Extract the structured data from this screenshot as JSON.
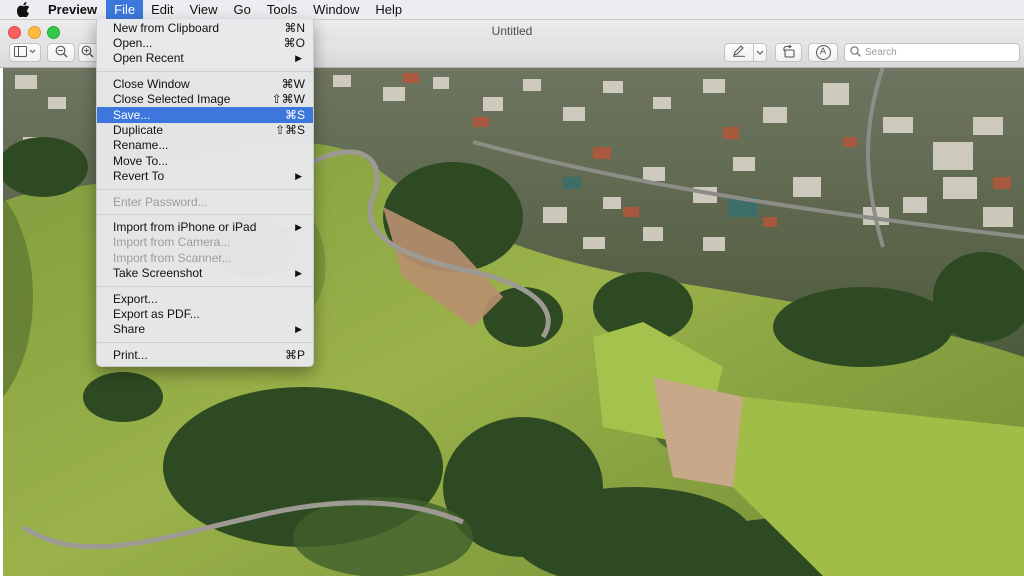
{
  "menubar": {
    "app_name": "Preview",
    "menus": [
      "File",
      "Edit",
      "View",
      "Go",
      "Tools",
      "Window",
      "Help"
    ],
    "active_menu": "File"
  },
  "window": {
    "title": "Untitled"
  },
  "toolbar": {
    "search_placeholder": "Search",
    "annotate_glyph": "A"
  },
  "file_menu": {
    "items": [
      {
        "label": "New from Clipboard",
        "shortcut": "⌘N"
      },
      {
        "label": "Open...",
        "shortcut": "⌘O"
      },
      {
        "label": "Open Recent",
        "submenu": "▶"
      },
      {
        "label": "Close Window",
        "shortcut": "⌘W"
      },
      {
        "label": "Close Selected Image",
        "shortcut": "⇧⌘W"
      },
      {
        "label": "Save...",
        "shortcut": "⌘S",
        "highlighted": true
      },
      {
        "label": "Duplicate",
        "shortcut": "⇧⌘S"
      },
      {
        "label": "Rename..."
      },
      {
        "label": "Move To..."
      },
      {
        "label": "Revert To",
        "submenu": "▶"
      },
      {
        "label": "Enter Password...",
        "disabled": true
      },
      {
        "label": "Import from iPhone or iPad",
        "submenu": "▶"
      },
      {
        "label": "Import from Camera...",
        "disabled": true
      },
      {
        "label": "Import from Scanner...",
        "disabled": true
      },
      {
        "label": "Take Screenshot",
        "submenu": "▶"
      },
      {
        "label": "Export..."
      },
      {
        "label": "Export as PDF..."
      },
      {
        "label": "Share",
        "submenu": "▶"
      },
      {
        "label": "Print...",
        "shortcut": "⌘P"
      }
    ]
  },
  "colors": {
    "menu_highlight": "#3d77dd",
    "close": "#fc605c",
    "minimize": "#fdbc40",
    "zoom": "#34c84a"
  },
  "icons": [
    "apple-logo-icon",
    "sidebar-toggle-icon",
    "zoom-out-icon",
    "zoom-in-icon",
    "markup-pen-icon",
    "chevron-down-icon",
    "rotate-icon",
    "annotate-icon",
    "search-icon"
  ]
}
